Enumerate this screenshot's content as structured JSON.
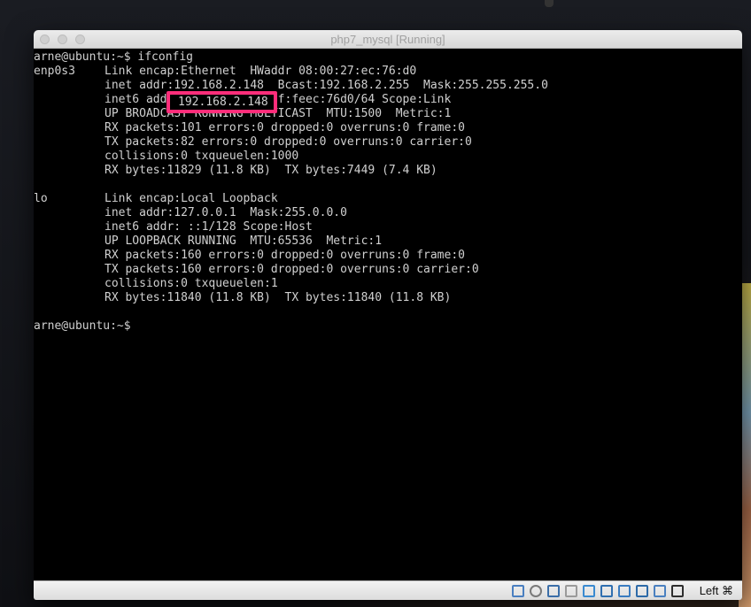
{
  "window": {
    "title": "php7_mysql [Running]"
  },
  "terminal": {
    "lines": [
      {
        "left": "arne@ubuntu:~$ ifconfig",
        "right": ""
      },
      {
        "left": "enp0s3",
        "right": "Link encap:Ethernet  HWaddr 08:00:27:ec:76:d0"
      },
      {
        "left": "",
        "right": "inet addr:192.168.2.148  Bcast:192.168.2.255  Mask:255.255.255.0"
      },
      {
        "left": "",
        "right": "inet6 addr: fe80::a00:27ff:feec:76d0/64 Scope:Link"
      },
      {
        "left": "",
        "right": "UP BROADCAST RUNNING MULTICAST  MTU:1500  Metric:1"
      },
      {
        "left": "",
        "right": "RX packets:101 errors:0 dropped:0 overruns:0 frame:0"
      },
      {
        "left": "",
        "right": "TX packets:82 errors:0 dropped:0 overruns:0 carrier:0"
      },
      {
        "left": "",
        "right": "collisions:0 txqueuelen:1000"
      },
      {
        "left": "",
        "right": "RX bytes:11829 (11.8 KB)  TX bytes:7449 (7.4 KB)"
      },
      {
        "left": "",
        "right": ""
      },
      {
        "left": "lo",
        "right": "Link encap:Local Loopback"
      },
      {
        "left": "",
        "right": "inet addr:127.0.0.1  Mask:255.0.0.0"
      },
      {
        "left": "",
        "right": "inet6 addr: ::1/128 Scope:Host"
      },
      {
        "left": "",
        "right": "UP LOOPBACK RUNNING  MTU:65536  Metric:1"
      },
      {
        "left": "",
        "right": "RX packets:160 errors:0 dropped:0 overruns:0 frame:0"
      },
      {
        "left": "",
        "right": "TX packets:160 errors:0 dropped:0 overruns:0 carrier:0"
      },
      {
        "left": "",
        "right": "collisions:0 txqueuelen:1"
      },
      {
        "left": "",
        "right": "RX bytes:11840 (11.8 KB)  TX bytes:11840 (11.8 KB)"
      },
      {
        "left": "",
        "right": ""
      },
      {
        "left": "arne@ubuntu:~$",
        "right": ""
      }
    ],
    "highlighted_ip": "192.168.2.148",
    "highlight_color": "#ff2d7a"
  },
  "status_bar": {
    "icons": [
      "hard-disk-icon",
      "optical-drive-icon",
      "usb-icon",
      "shared-folders-icon",
      "pencil-icon",
      "display-icon",
      "network-icon",
      "video-capture-icon",
      "cpu-icon",
      "keyboard-arrow-icon"
    ],
    "host_key_label": "Left ⌘"
  }
}
